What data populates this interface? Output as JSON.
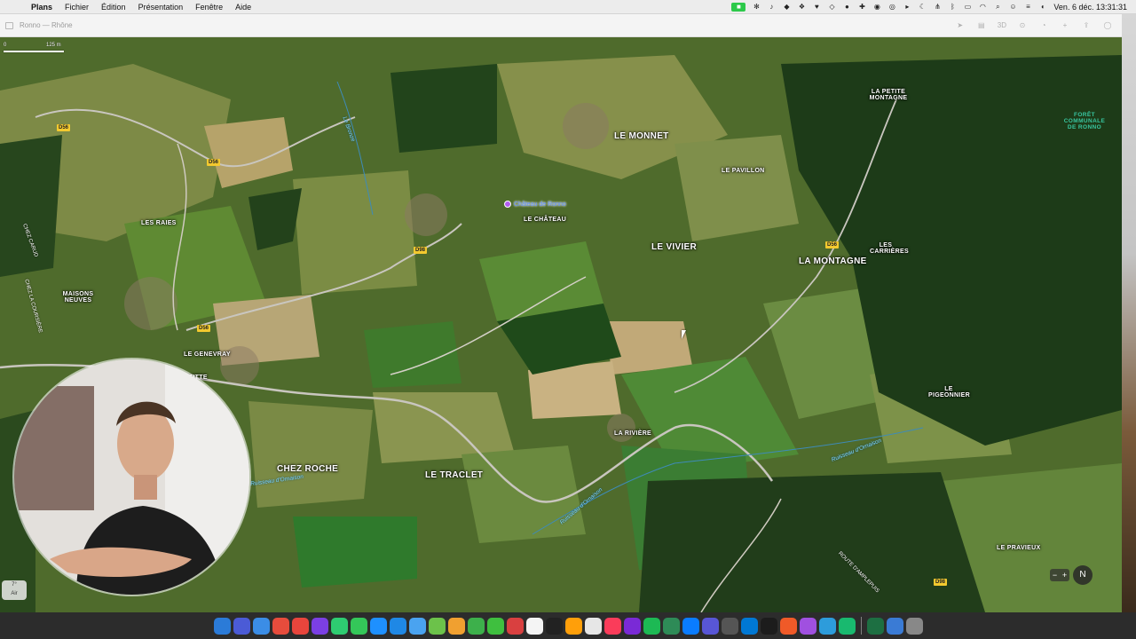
{
  "menubar": {
    "apple_icon": "apple-icon",
    "app_name": "Plans",
    "menus": [
      "Fichier",
      "Édition",
      "Présentation",
      "Fenêtre",
      "Aide"
    ],
    "clock": "Ven. 6 déc.  13:31:31"
  },
  "window": {
    "title": "Ronno — Rhône",
    "view_mode": "3D"
  },
  "map": {
    "scale": {
      "zero": "0",
      "distance": "125 m"
    },
    "places_big": [
      {
        "label": "LE MONNET"
      },
      {
        "label": "LE VIVIER"
      },
      {
        "label": "LA MONTAGNE"
      },
      {
        "label": "CHEZ ROCHE"
      },
      {
        "label": "LE TRACLET"
      }
    ],
    "places_small": [
      {
        "label": "LE PAVILLON"
      },
      {
        "label": "LE CHÂTEAU"
      },
      {
        "label": "LES RAIES"
      },
      {
        "label": "LE GENEVRAY"
      },
      {
        "label": "PIERREFITTE"
      },
      {
        "label": "LA RIVIÈRE"
      },
      {
        "label": "LE PRAVIEUX"
      }
    ],
    "places_multi": [
      {
        "label": "LA PETITE MONTAGNE"
      },
      {
        "label": "LES CARRIÈRES"
      },
      {
        "label": "MAISONS NEUVES"
      },
      {
        "label": "LE PIGEONNIER"
      }
    ],
    "forest_label": "FORÊT COMMUNALE DE RONNO",
    "poi": {
      "label": "Château de Ronno"
    },
    "roads": [
      "D56",
      "D56",
      "D56",
      "D98",
      "D56",
      "D98"
    ],
    "streams": [
      "Ruisseau d'Ornaison",
      "Ruisseau d'Ornaison",
      "Ruisseau d'Ornaison",
      "Le Bronze"
    ],
    "road_names": [
      "CHEZ CARUD",
      "CHEZ LA COURSIÈRE",
      "ROUTE D'AMPLEPUIS"
    ],
    "weather": {
      "temp": "7°",
      "aqi": "Air"
    },
    "compass": "N",
    "colors": {
      "road_badge": "#f3c92f",
      "stream": "#7ed5ff",
      "poi_pin": "#b25cf0",
      "forest_label": "#38c6a0"
    }
  }
}
